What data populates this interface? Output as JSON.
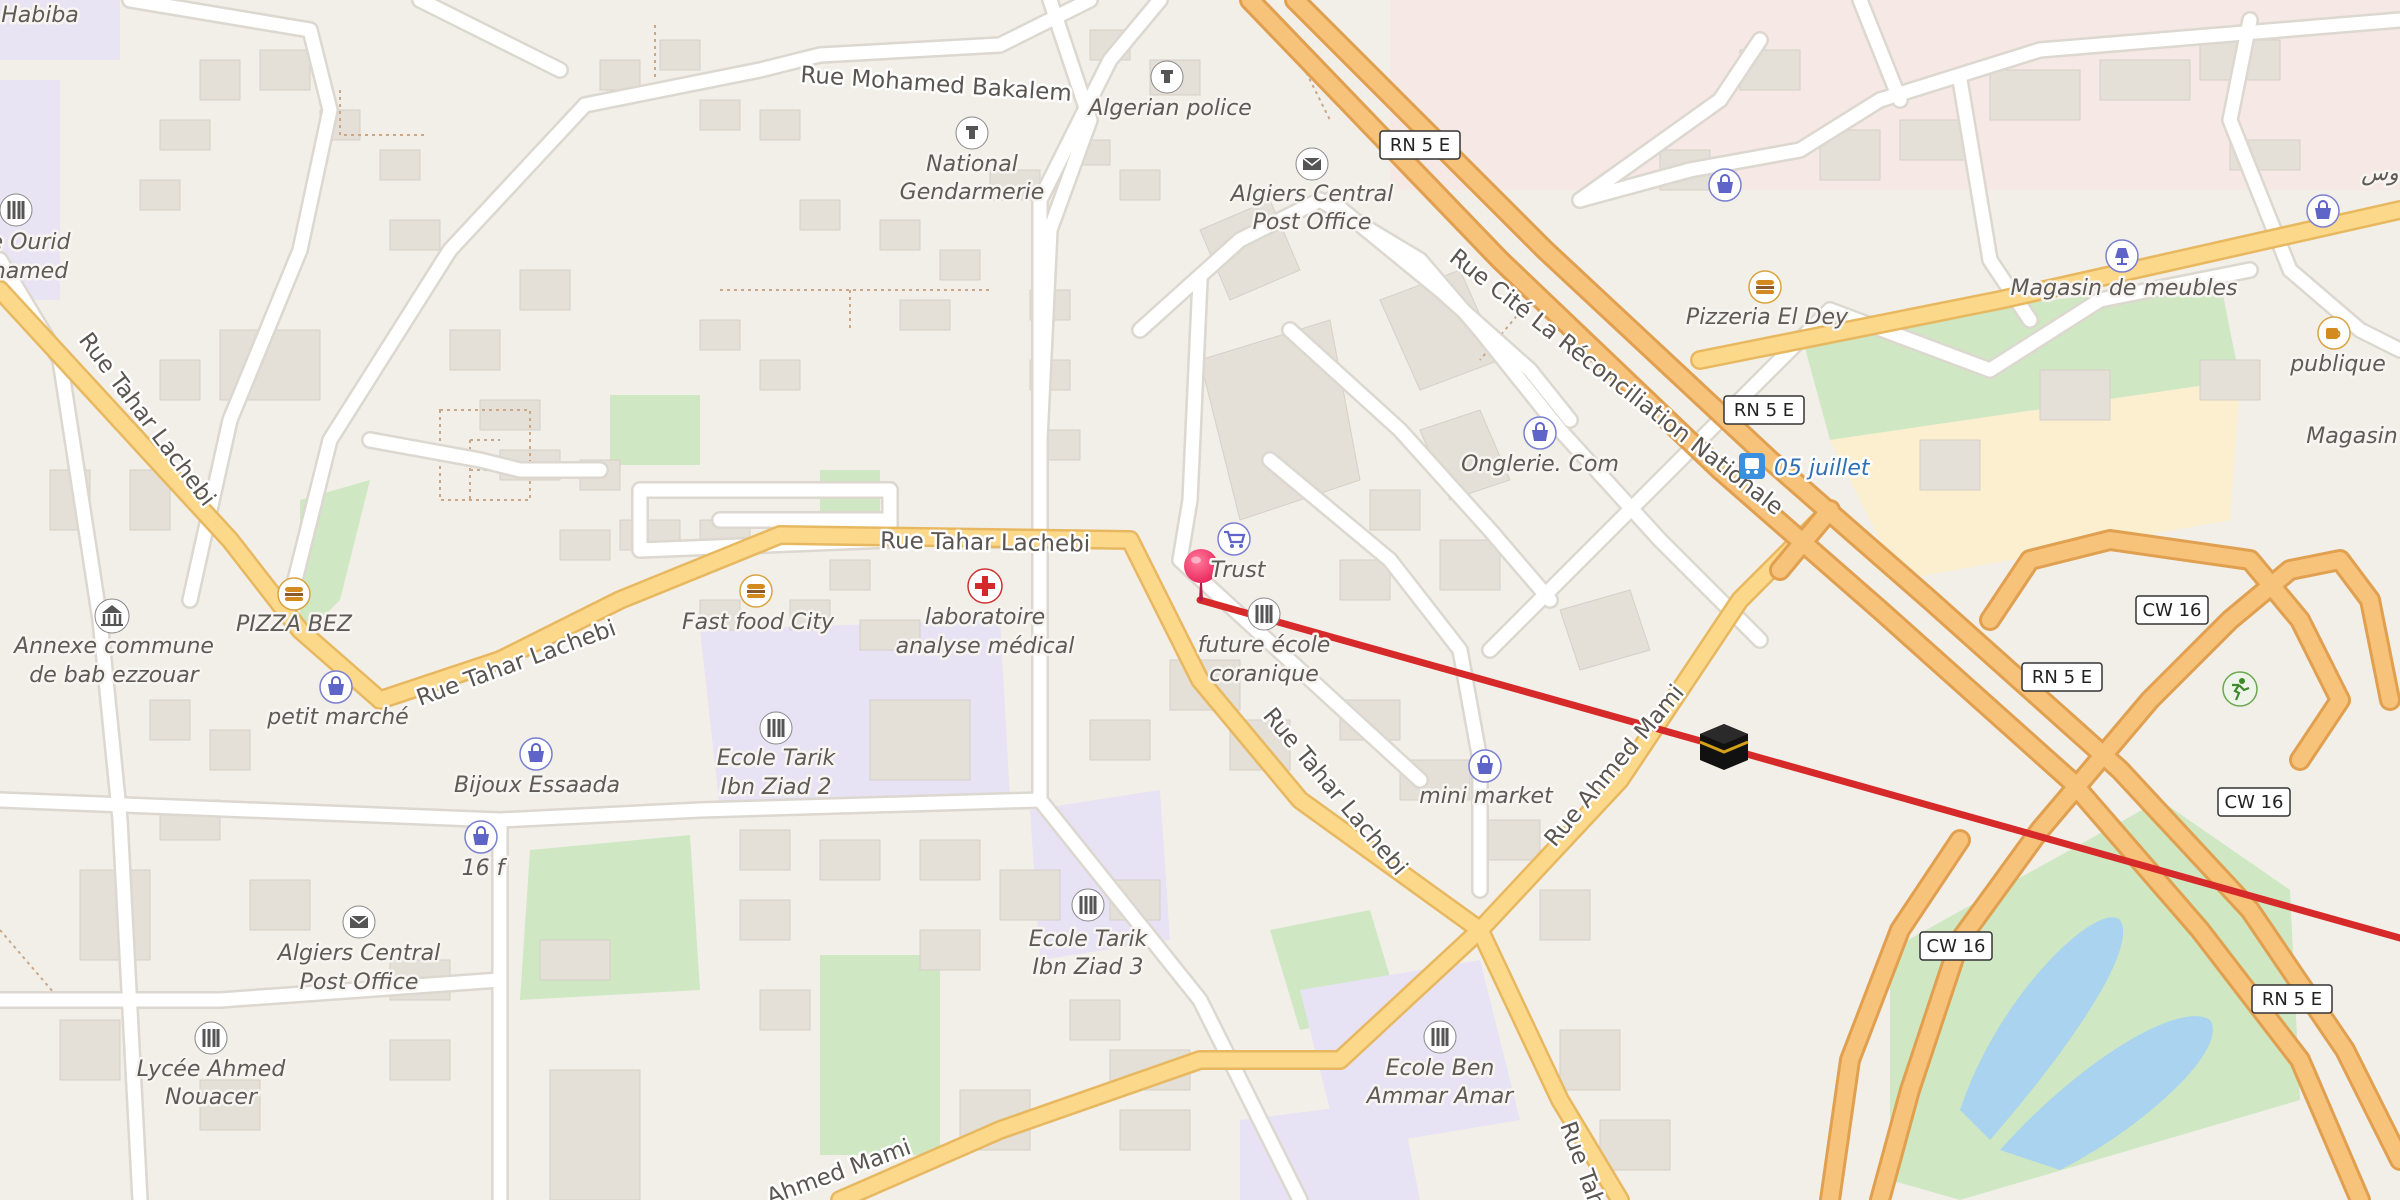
{
  "map": {
    "background": "#f2efe9",
    "route_color": "#d62a2a",
    "pin_color": "#e8245a",
    "streets": {
      "mohamed_bakalem": "Rue Mohamed Bakalem",
      "tahar_lachebi_top": "Rue Tahar Lachebi",
      "tahar_lachebi_left": "Rue Tahar Lachebi",
      "tahar_lachebi_mid": "Rue Tahar Lachebi",
      "tahar_lachebi_diag": "Rue Tahar Lachebi",
      "tahar_lachebi_bottom": "Rue Tah",
      "ahmed_mami": "Rue Ahmed Mami",
      "ahmed_mami_bottom": "Ahmed Mami",
      "cite_reconciliation": "Rue Cité La Réconciliation Nationale"
    },
    "shields": [
      "RN 5 E",
      "RN 5 E",
      "RN 5 E",
      "RN 5 E",
      "CW 16",
      "CW 16",
      "CW 16"
    ],
    "pois": {
      "habiba": "Habiba",
      "algerian_police": "Algerian police",
      "national_gendarmerie": "National Gendarmerie",
      "algiers_post_top": "Algiers Central Post Office",
      "ourid": "e Ourid",
      "hamed": "hamed",
      "pizzeria_el_dey": "Pizzeria El Dey",
      "magasin_meubles": "Magasin de meubles",
      "publique": "publique",
      "magasin": "Magasin",
      "onglerie": "Onglerie. Com",
      "bus_stop": "05 juillet",
      "trust": "Trust",
      "future_ecole": "future école coranique",
      "laboratoire": "laboratoire analyse médical",
      "fast_food": "Fast food City",
      "pizza_bez": "PIZZA BEZ",
      "annexe": "Annexe commune de bab ezzouar",
      "petit_marche": "petit marché",
      "bijoux": "Bijoux Essaada",
      "ecole_tarik_2": "Ecole Tarik Ibn Ziad 2",
      "sixteen_f": "16 f",
      "algiers_post_bottom": "Algiers Central Post Office",
      "lycee": "Lycée Ahmed Nouacer",
      "ecole_tarik_3": "Ecole Tarik Ibn Ziad 3",
      "mini_market": "mini market",
      "ecole_ben_ammar": "Ecole Ben Ammar Amar",
      "top_right_arabic": "وس"
    }
  }
}
